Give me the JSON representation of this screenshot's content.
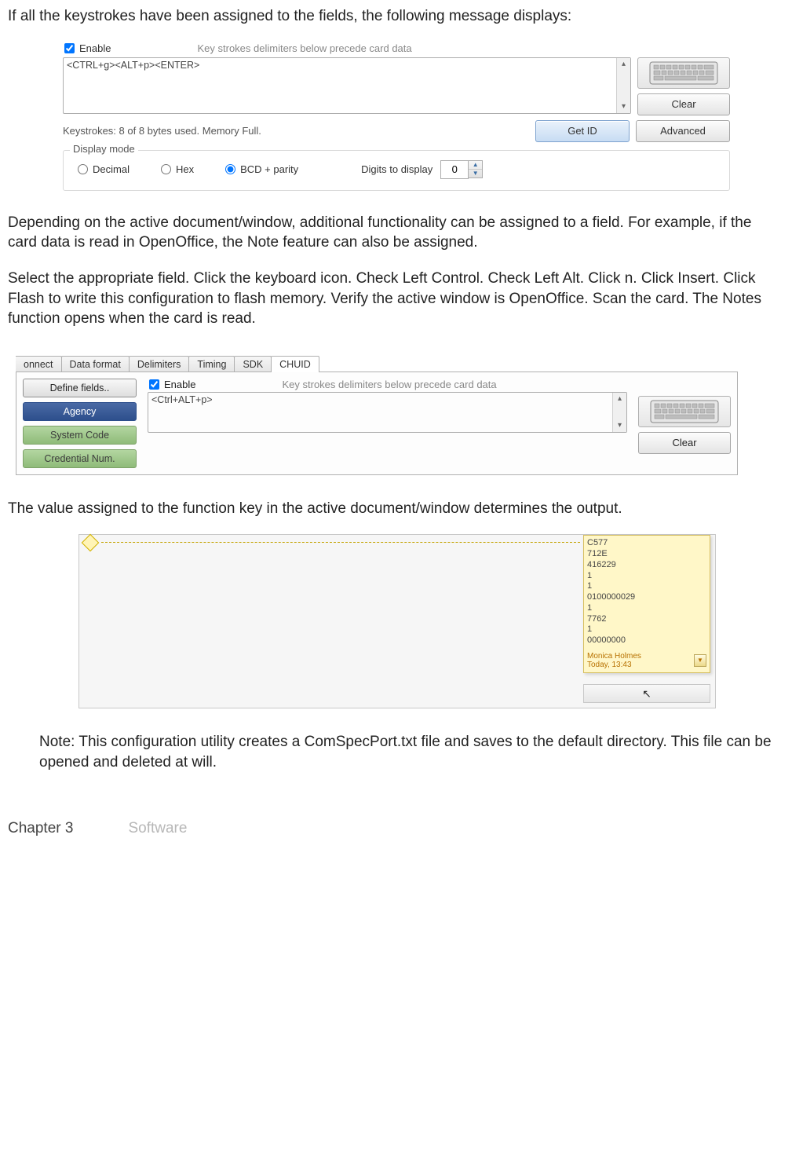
{
  "para1": "If all the keystrokes have been assigned to the fields, the following message displays:",
  "ss1": {
    "enable_label": "Enable",
    "caption": "Key strokes delimiters below precede card data",
    "textarea_value": "<CTRL+g><ALT+p><ENTER>",
    "clear_btn": "Clear",
    "status": "Keystrokes: 8 of 8 bytes used. Memory Full.",
    "getid_btn": "Get ID",
    "advanced_btn": "Advanced",
    "fieldset_legend": "Display mode",
    "radio_decimal": "Decimal",
    "radio_hex": "Hex",
    "radio_bcd": "BCD + parity",
    "digits_label": "Digits to display",
    "digits_value": "0"
  },
  "para2": "Depending on the active document/window, additional functionality can be assigned to a field. For example, if the card data is read in OpenOffice, the Note feature can also be assigned.",
  "para3": "Select the appropriate field. Click the keyboard icon. Check Left Control. Check Left Alt. Click n. Click Insert. Click Flash to write this configuration to flash memory. Verify the active window is OpenOffice.  Scan the card. The Notes function opens when the card is read.",
  "ss2": {
    "tabs": [
      "onnect",
      "Data format",
      "Delimiters",
      "Timing",
      "SDK",
      "CHUID"
    ],
    "define_btn": "Define fields..",
    "agency_btn": "Agency",
    "syscode_btn": "System Code",
    "cred_btn": "Credential Num.",
    "enable_label": "Enable",
    "caption": "Key strokes delimiters below precede card data",
    "textarea_value": "<Ctrl+ALT+p>",
    "clear_btn": "Clear"
  },
  "para4": "The value assigned to the function key in the active document/window determines the output.",
  "ss3": {
    "note_lines": [
      "C577",
      "712E",
      "416229",
      "1",
      "1",
      "0100000029",
      "1",
      "7762",
      "1",
      "00000000"
    ],
    "meta_author": "Monica Holmes",
    "meta_time": "Today, 13:43"
  },
  "para5": "Note: This configuration utility creates a ComSpecPort.txt file and saves to the default directory. This file can be opened and deleted at will.",
  "footer_chapter": "Chapter 3",
  "footer_section": "Software"
}
